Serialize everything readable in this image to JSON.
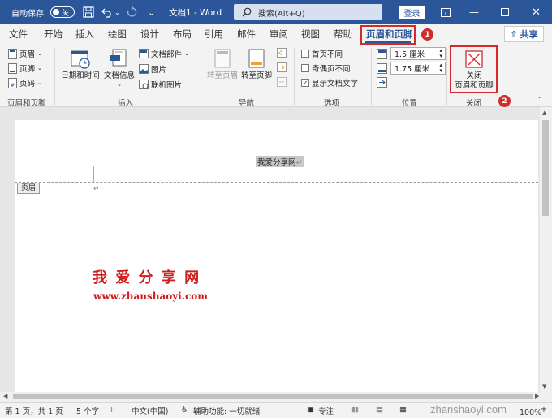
{
  "titlebar": {
    "autosave_label": "自动保存",
    "autosave_state": "关",
    "doc_title": "文档1 - Word",
    "search_placeholder": "搜索(Alt+Q)",
    "login_label": "登录"
  },
  "tabs": [
    "文件",
    "开始",
    "插入",
    "绘图",
    "设计",
    "布局",
    "引用",
    "邮件",
    "审阅",
    "视图",
    "帮助",
    "页眉和页脚"
  ],
  "share_label": "共享",
  "ribbon": {
    "hf_group": {
      "header": "页眉",
      "footer": "页脚",
      "page_number": "页码",
      "label": "页眉和页脚"
    },
    "insert_group": {
      "date_time": "日期和时间",
      "doc_info": "文档信息",
      "doc_parts": "文档部件",
      "picture": "图片",
      "online_picture": "联机图片",
      "label": "插入"
    },
    "nav_group": {
      "goto_header": "转至页眉",
      "goto_footer": "转至页脚",
      "label": "导航"
    },
    "options_group": {
      "first_page": "首页不同",
      "odd_even": "奇偶页不同",
      "show_text": "显示文档文字",
      "label": "选项"
    },
    "position_group": {
      "header_pos": "1.5 厘米",
      "footer_pos": "1.75 厘米",
      "label": "位置"
    },
    "close_group": {
      "close_line1": "关闭",
      "close_line2": "页眉和页脚",
      "label": "关闭"
    }
  },
  "badges": {
    "one": "1",
    "two": "2"
  },
  "document": {
    "header_text": "我爱分享网",
    "header_tag": "页眉",
    "watermark_cn": "我 爱 分 享 网",
    "watermark_url": "www.zhanshaoyi.com"
  },
  "statusbar": {
    "page": "第 1 页，共 1 页",
    "words": "5 个字",
    "lang": "中文(中国)",
    "accessibility": "辅助功能: 一切就绪",
    "focus": "专注",
    "zoom": "100%",
    "site_watermark": "zhanshaoyi.com"
  },
  "colors": {
    "accent": "#2b579a",
    "highlight": "#d42a2a",
    "watermark": "#cc1f1f"
  }
}
